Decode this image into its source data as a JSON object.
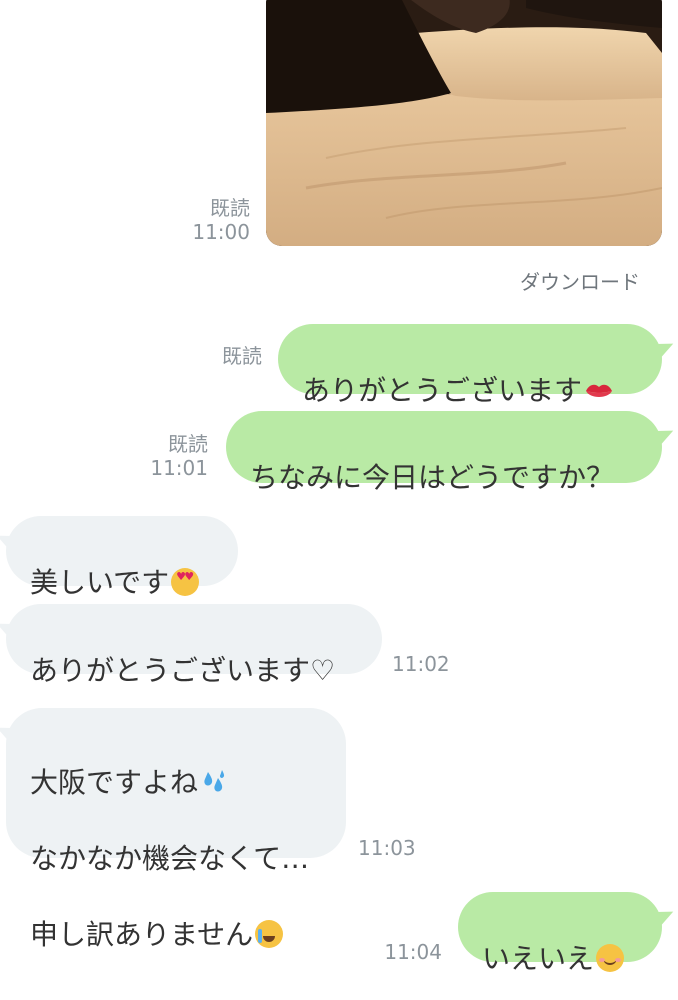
{
  "image_message": {
    "read_status": "既読",
    "time": "11:00",
    "download_label": "ダウンロード"
  },
  "messages": [
    {
      "dir": "out",
      "text": "ありがとうございます",
      "emoji": "kiss-lips-icon",
      "read_status": "既読",
      "time": ""
    },
    {
      "dir": "out",
      "text": "ちなみに今日はどうですか？",
      "read_status": "既読",
      "time": "11:01"
    },
    {
      "dir": "in",
      "text": "美しいです",
      "emoji": "heart-eyes-face-icon",
      "time": ""
    },
    {
      "dir": "in",
      "text": "ありがとうございます♡",
      "time": "11:02"
    },
    {
      "dir": "in",
      "lines": [
        "大阪ですよね",
        "なかなか機会なくて…",
        "申し訳ありません"
      ],
      "emojis": [
        "sweat-droplets-icon",
        "",
        "crying-face-icon"
      ],
      "time": "11:03"
    },
    {
      "dir": "out",
      "text": "いえいえ",
      "emoji": "smiling-face-icon",
      "time": "11:04"
    }
  ],
  "colors": {
    "outgoing_bubble": "#b9eaa5",
    "incoming_bubble": "#eef2f4",
    "meta_text": "#8c949b"
  }
}
